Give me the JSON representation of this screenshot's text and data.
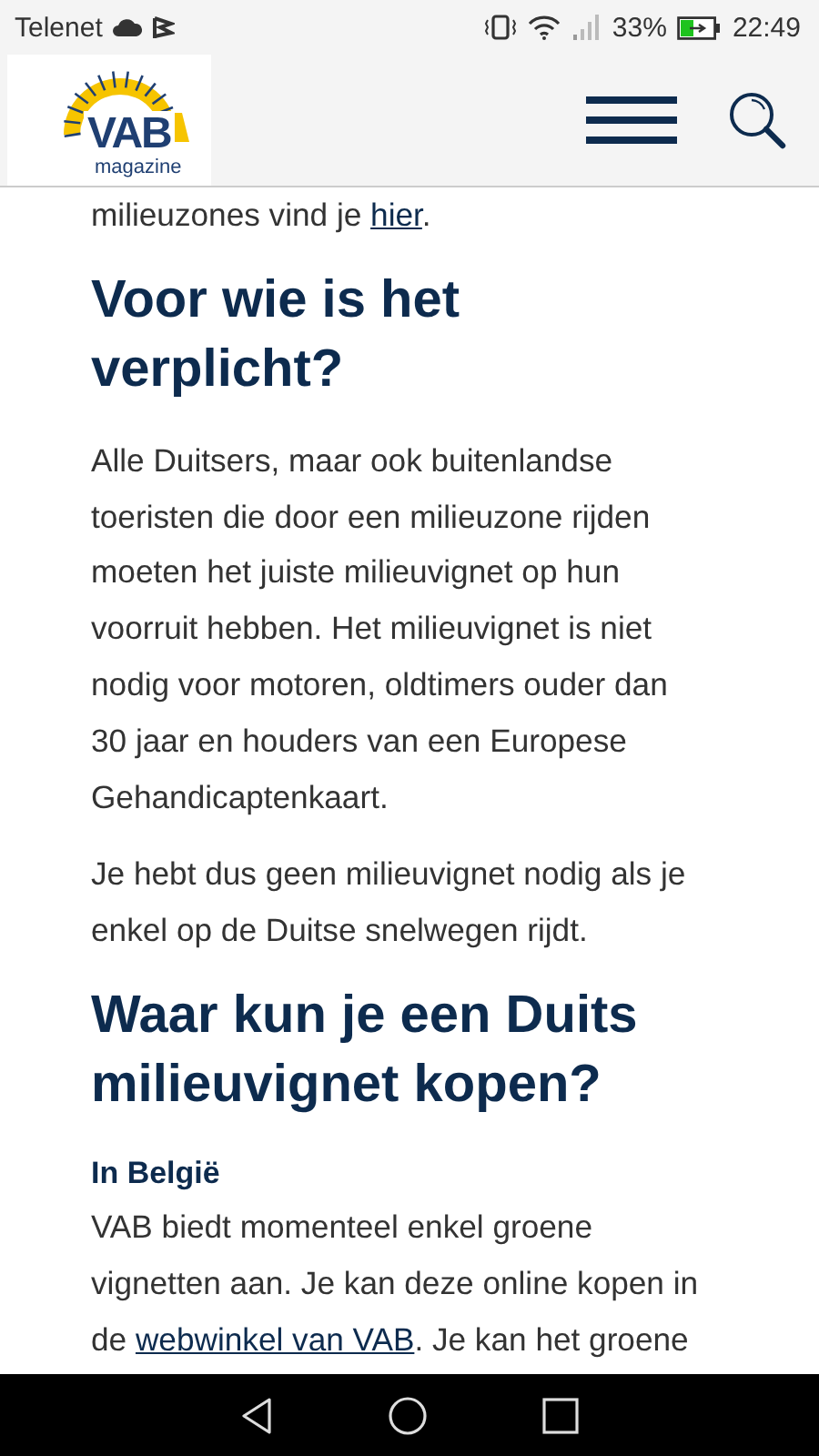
{
  "status_bar": {
    "carrier": "Telenet",
    "battery": "33%",
    "time": "22:49"
  },
  "header": {
    "logo": {
      "wordmark": "VAB",
      "subtitle": "magazine"
    }
  },
  "article": [
    {
      "kind": "paragraph",
      "parts": [
        {
          "text": "milieuzones vind je "
        },
        {
          "text": "hier",
          "link": true
        },
        {
          "text": "."
        }
      ]
    },
    {
      "kind": "heading",
      "text": "Voor wie is het verplicht?"
    },
    {
      "kind": "paragraph",
      "parts": [
        {
          "text": "Alle Duitsers, maar ook buitenlandse toeristen die door een milieuzone rijden moeten het juiste milieuvignet op hun voorruit hebben. Het milieuvignet is niet nodig voor motoren, oldtimers ouder dan 30 jaar en houders van een Europese Gehandicaptenkaart."
        }
      ]
    },
    {
      "kind": "paragraph",
      "parts": [
        {
          "text": "Je hebt dus geen milieuvignet nodig als je enkel op de Duitse snelwegen rijdt."
        }
      ]
    },
    {
      "kind": "heading",
      "text": "Waar kun je een Duits milieuvignet kopen?"
    },
    {
      "kind": "subheading",
      "text": "In België"
    },
    {
      "kind": "paragraph",
      "parts": [
        {
          "text": "VAB biedt momenteel enkel groene vignetten aan. Je kan deze online kopen in de "
        },
        {
          "text": "webwinkel van VAB",
          "link": true
        },
        {
          "text": ". Je kan het groene"
        }
      ]
    }
  ]
}
